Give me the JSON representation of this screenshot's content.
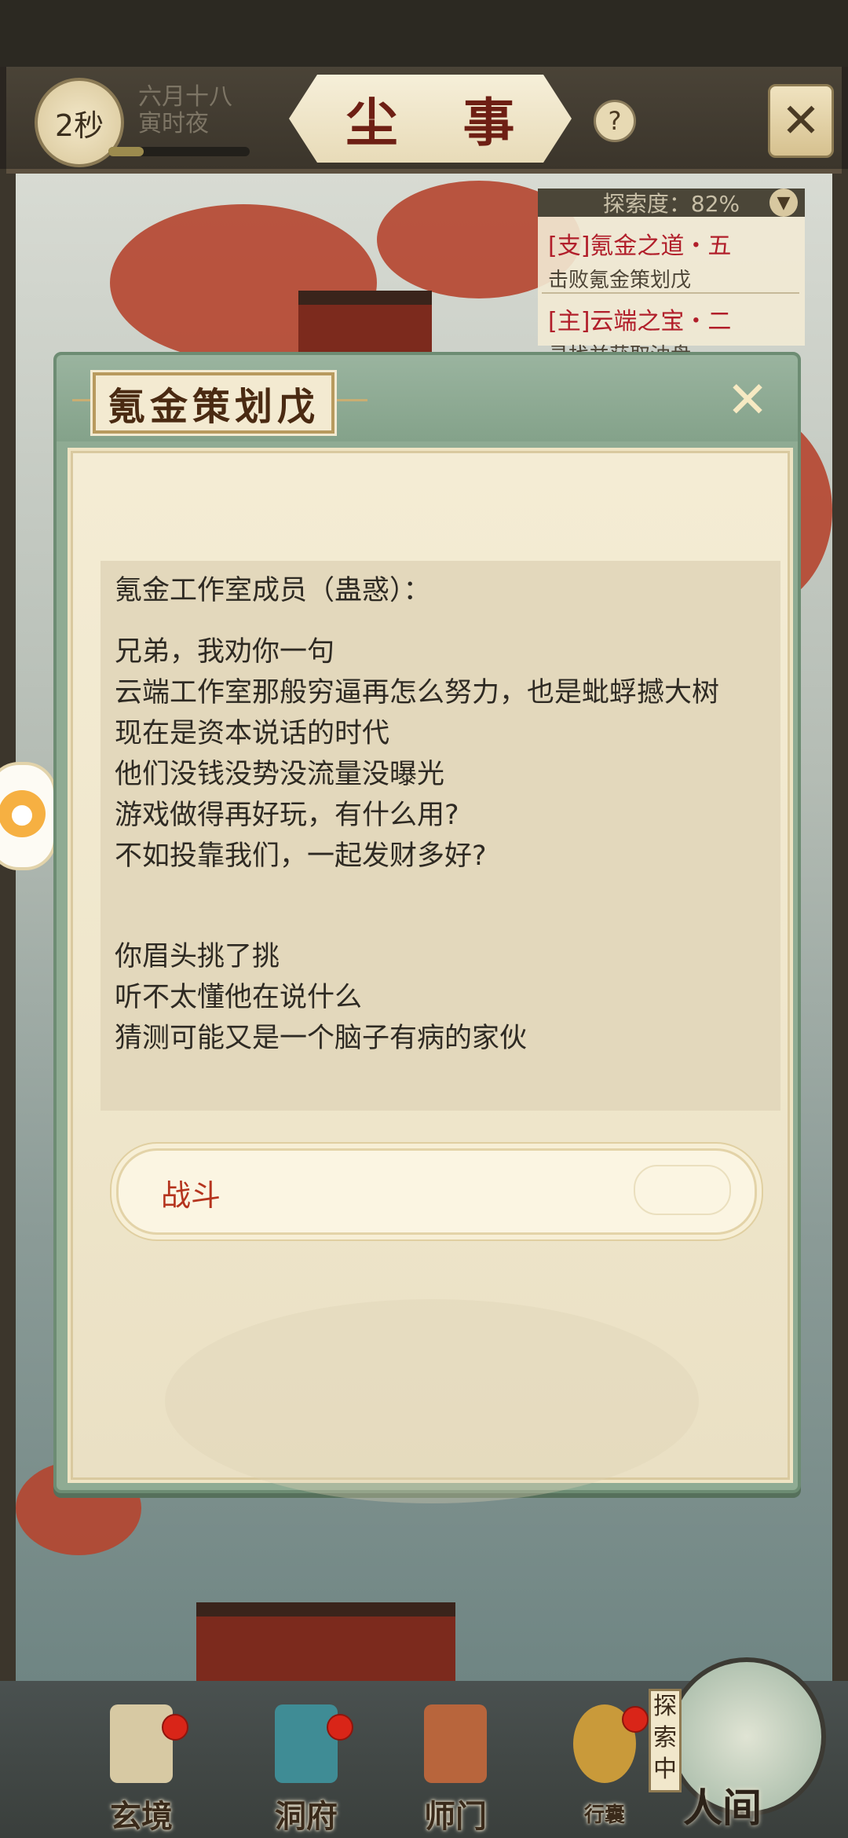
{
  "header": {
    "timer": "2秒",
    "date_line1": "六月十八",
    "date_line2": "寅时夜",
    "title": "尘 事",
    "help": "?",
    "close_glyph": "✕"
  },
  "quest": {
    "header": "探索度：82%",
    "items": [
      {
        "title": "[支]氪金之道・五",
        "subtitle": "击败氪金策划戊"
      },
      {
        "title": "[主]云端之宝・二",
        "subtitle": "寻找并获取油盘"
      }
    ]
  },
  "dialog": {
    "title": "氪金策划戊",
    "close_glyph": "✕",
    "speaker": "氪金工作室成员（蛊惑）：",
    "lines_a": [
      "兄弟，我劝你一句",
      "云端工作室那般穷逼再怎么努力，也是蚍蜉撼大树",
      "现在是资本说话的时代",
      "他们没钱没势没流量没曝光",
      "游戏做得再好玩，有什么用?",
      "不如投靠我们，一起发财多好?"
    ],
    "lines_b": [
      "你眉头挑了挑",
      "听不太懂他在说什么",
      "猜测可能又是一个脑子有病的家伙"
    ],
    "option": "战斗"
  },
  "bottom_nav": {
    "items": [
      "玄境",
      "洞府",
      "师门",
      "行囊"
    ],
    "explore_tag": "探索中",
    "world": "人间"
  },
  "colors": {
    "title_red": "#6e1f14",
    "quest_red": "#b11e2a",
    "option_red": "#b5341e",
    "dialog_green": "#8fab93"
  }
}
